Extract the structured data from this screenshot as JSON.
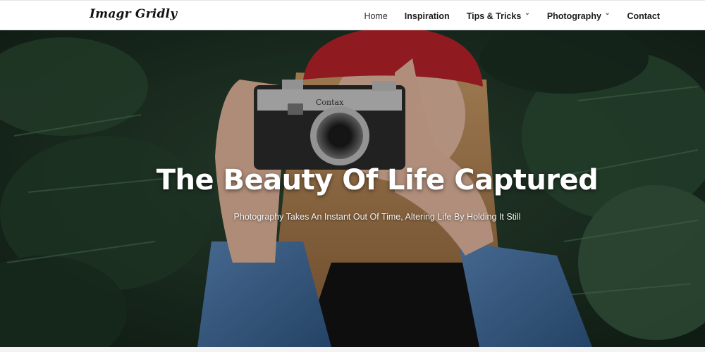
{
  "site": {
    "logo": "Imagr Gridly"
  },
  "nav": {
    "items": [
      {
        "label": "Home"
      },
      {
        "label": "Inspiration"
      },
      {
        "label": "Tips & Tricks"
      },
      {
        "label": "Photography"
      },
      {
        "label": "Contact"
      }
    ]
  },
  "hero": {
    "title": "The Beauty Of Life Captured",
    "subtitle": "Photography Takes An Instant Out Of Time, Altering Life By Holding It Still",
    "camera_brand": "Contax"
  },
  "colors": {
    "hat": "#b8232b",
    "denim": "#3d6aa0",
    "foliage": "#1e3a29",
    "header_bg": "#ffffff"
  },
  "icons": {
    "dropdown": "chevron-down-icon"
  }
}
